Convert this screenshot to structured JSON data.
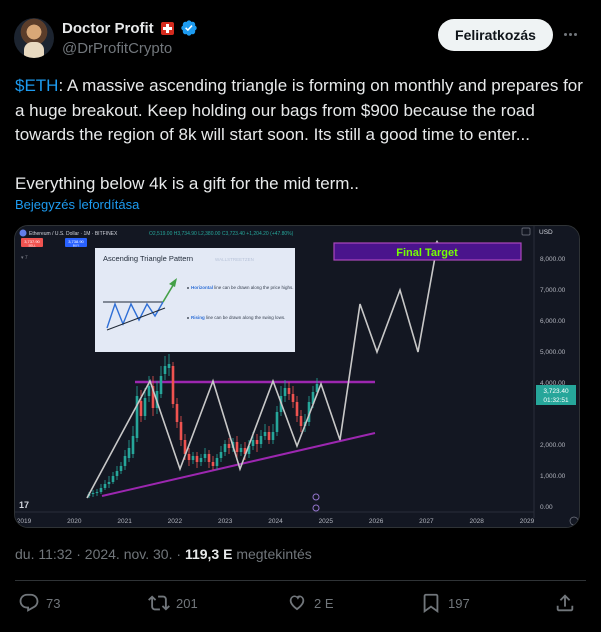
{
  "author": {
    "name": "Doctor Profit",
    "handle": "@DrProfitCrypto"
  },
  "subscribe_label": "Feliratkozás",
  "tweet": {
    "cashtag": "$ETH",
    "text_rest": ": A massive ascending triangle is forming on monthly and prepares for a huge breakout. Keep holding our bags from $900 because the road towards the region of 8k will start soon. Its still a good time to enter...",
    "text_second": "Everything below 4k is a gift for the mid term..",
    "translate_label": "Bejegyzés lefordítása"
  },
  "chart": {
    "header_text": "Ethereum / U.S. Dollar · 1M · BITFINEX",
    "ohlc_text": "O2,519.00 H3,734.90 L2,380.00 C3,723.40 +1,204.20 (+47.80%)",
    "sell_price": "3,737.90",
    "sell_label": "SELL",
    "buy_price": "3,738.90",
    "buy_label": "BUY",
    "currency": "USD",
    "y_ticks": [
      "8,000.00",
      "7,000.00",
      "6,000.00",
      "5,000.00",
      "4,000.00",
      "2,000.00",
      "1,000.00",
      "0.00"
    ],
    "x_ticks": [
      "2019",
      "2020",
      "2021",
      "2022",
      "2023",
      "2024",
      "2025",
      "2026",
      "2027",
      "2028",
      "2029"
    ],
    "price_tag": "3,723.40",
    "countdown": "01:32:51",
    "final_target": "Final Target",
    "inset_title": "Ascending Triangle Pattern",
    "inset_brand": "WALLSTREETZEN",
    "inset_note1_bold": "Horizontal",
    "inset_note1_rest": " line can be drawn along the price highs.",
    "inset_note2_bold": "Rising",
    "inset_note2_rest": " line can be drawn along the swing lows.",
    "tv_logo": "17",
    "colors": {
      "up": "#26a69a",
      "down": "#ef5350",
      "resistance": "#9c27b0",
      "projection": "#c8c8c8",
      "target_bg": "#4a148c",
      "target_text": "#76ff03"
    }
  },
  "meta": {
    "timestamp": "du. 11:32 · 2024. nov. 30. · ",
    "views_count": "119,3 E",
    "views_label": " megtekintés"
  },
  "actions": {
    "replies": "73",
    "reposts": "201",
    "likes": "2 E",
    "bookmarks": "197"
  }
}
